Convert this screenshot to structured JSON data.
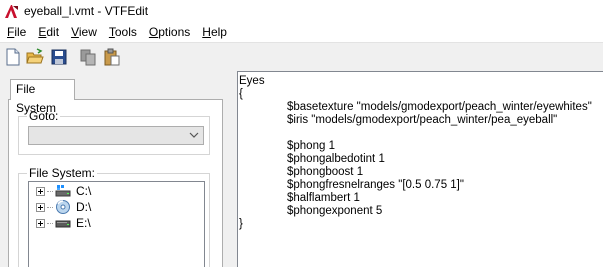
{
  "window": {
    "title": "eyeball_l.vmt - VTFEdit"
  },
  "menu": [
    {
      "pre": "",
      "ul": "F",
      "post": "ile"
    },
    {
      "pre": "",
      "ul": "E",
      "post": "dit"
    },
    {
      "pre": "",
      "ul": "V",
      "post": "iew"
    },
    {
      "pre": "",
      "ul": "T",
      "post": "ools"
    },
    {
      "pre": "",
      "ul": "O",
      "post": "ptions"
    },
    {
      "pre": "",
      "ul": "H",
      "post": "elp"
    }
  ],
  "toolbar": {
    "icons": [
      "new-file-icon",
      "open-folder-icon",
      "save-icon",
      "copy-icon",
      "paste-icon"
    ]
  },
  "left_panel": {
    "tab_label": "File System",
    "goto_label": "Goto:",
    "goto_value": "",
    "filesystem_label": "File System:",
    "drives": [
      "C:\\",
      "D:\\",
      "E:\\"
    ]
  },
  "editor": {
    "lines": [
      "Eyes",
      "{",
      "\t$basetexture \"models/gmodexport/peach_winter/eyewhites\"",
      "\t$iris \"models/gmodexport/peach_winter/pea_eyeball\"",
      "",
      "\t$phong 1",
      "\t$phongalbedotint 1",
      "\t$phongboost 1",
      "\t$phongfresnelranges \"[0.5 0.75 1]\"",
      "\t$halflambert 1",
      "\t$phongexponent 5",
      "}"
    ]
  },
  "colors": {
    "accent": "#cc2222",
    "window_bg": "#f0f0f0",
    "editor_bg": "#ffffff"
  }
}
